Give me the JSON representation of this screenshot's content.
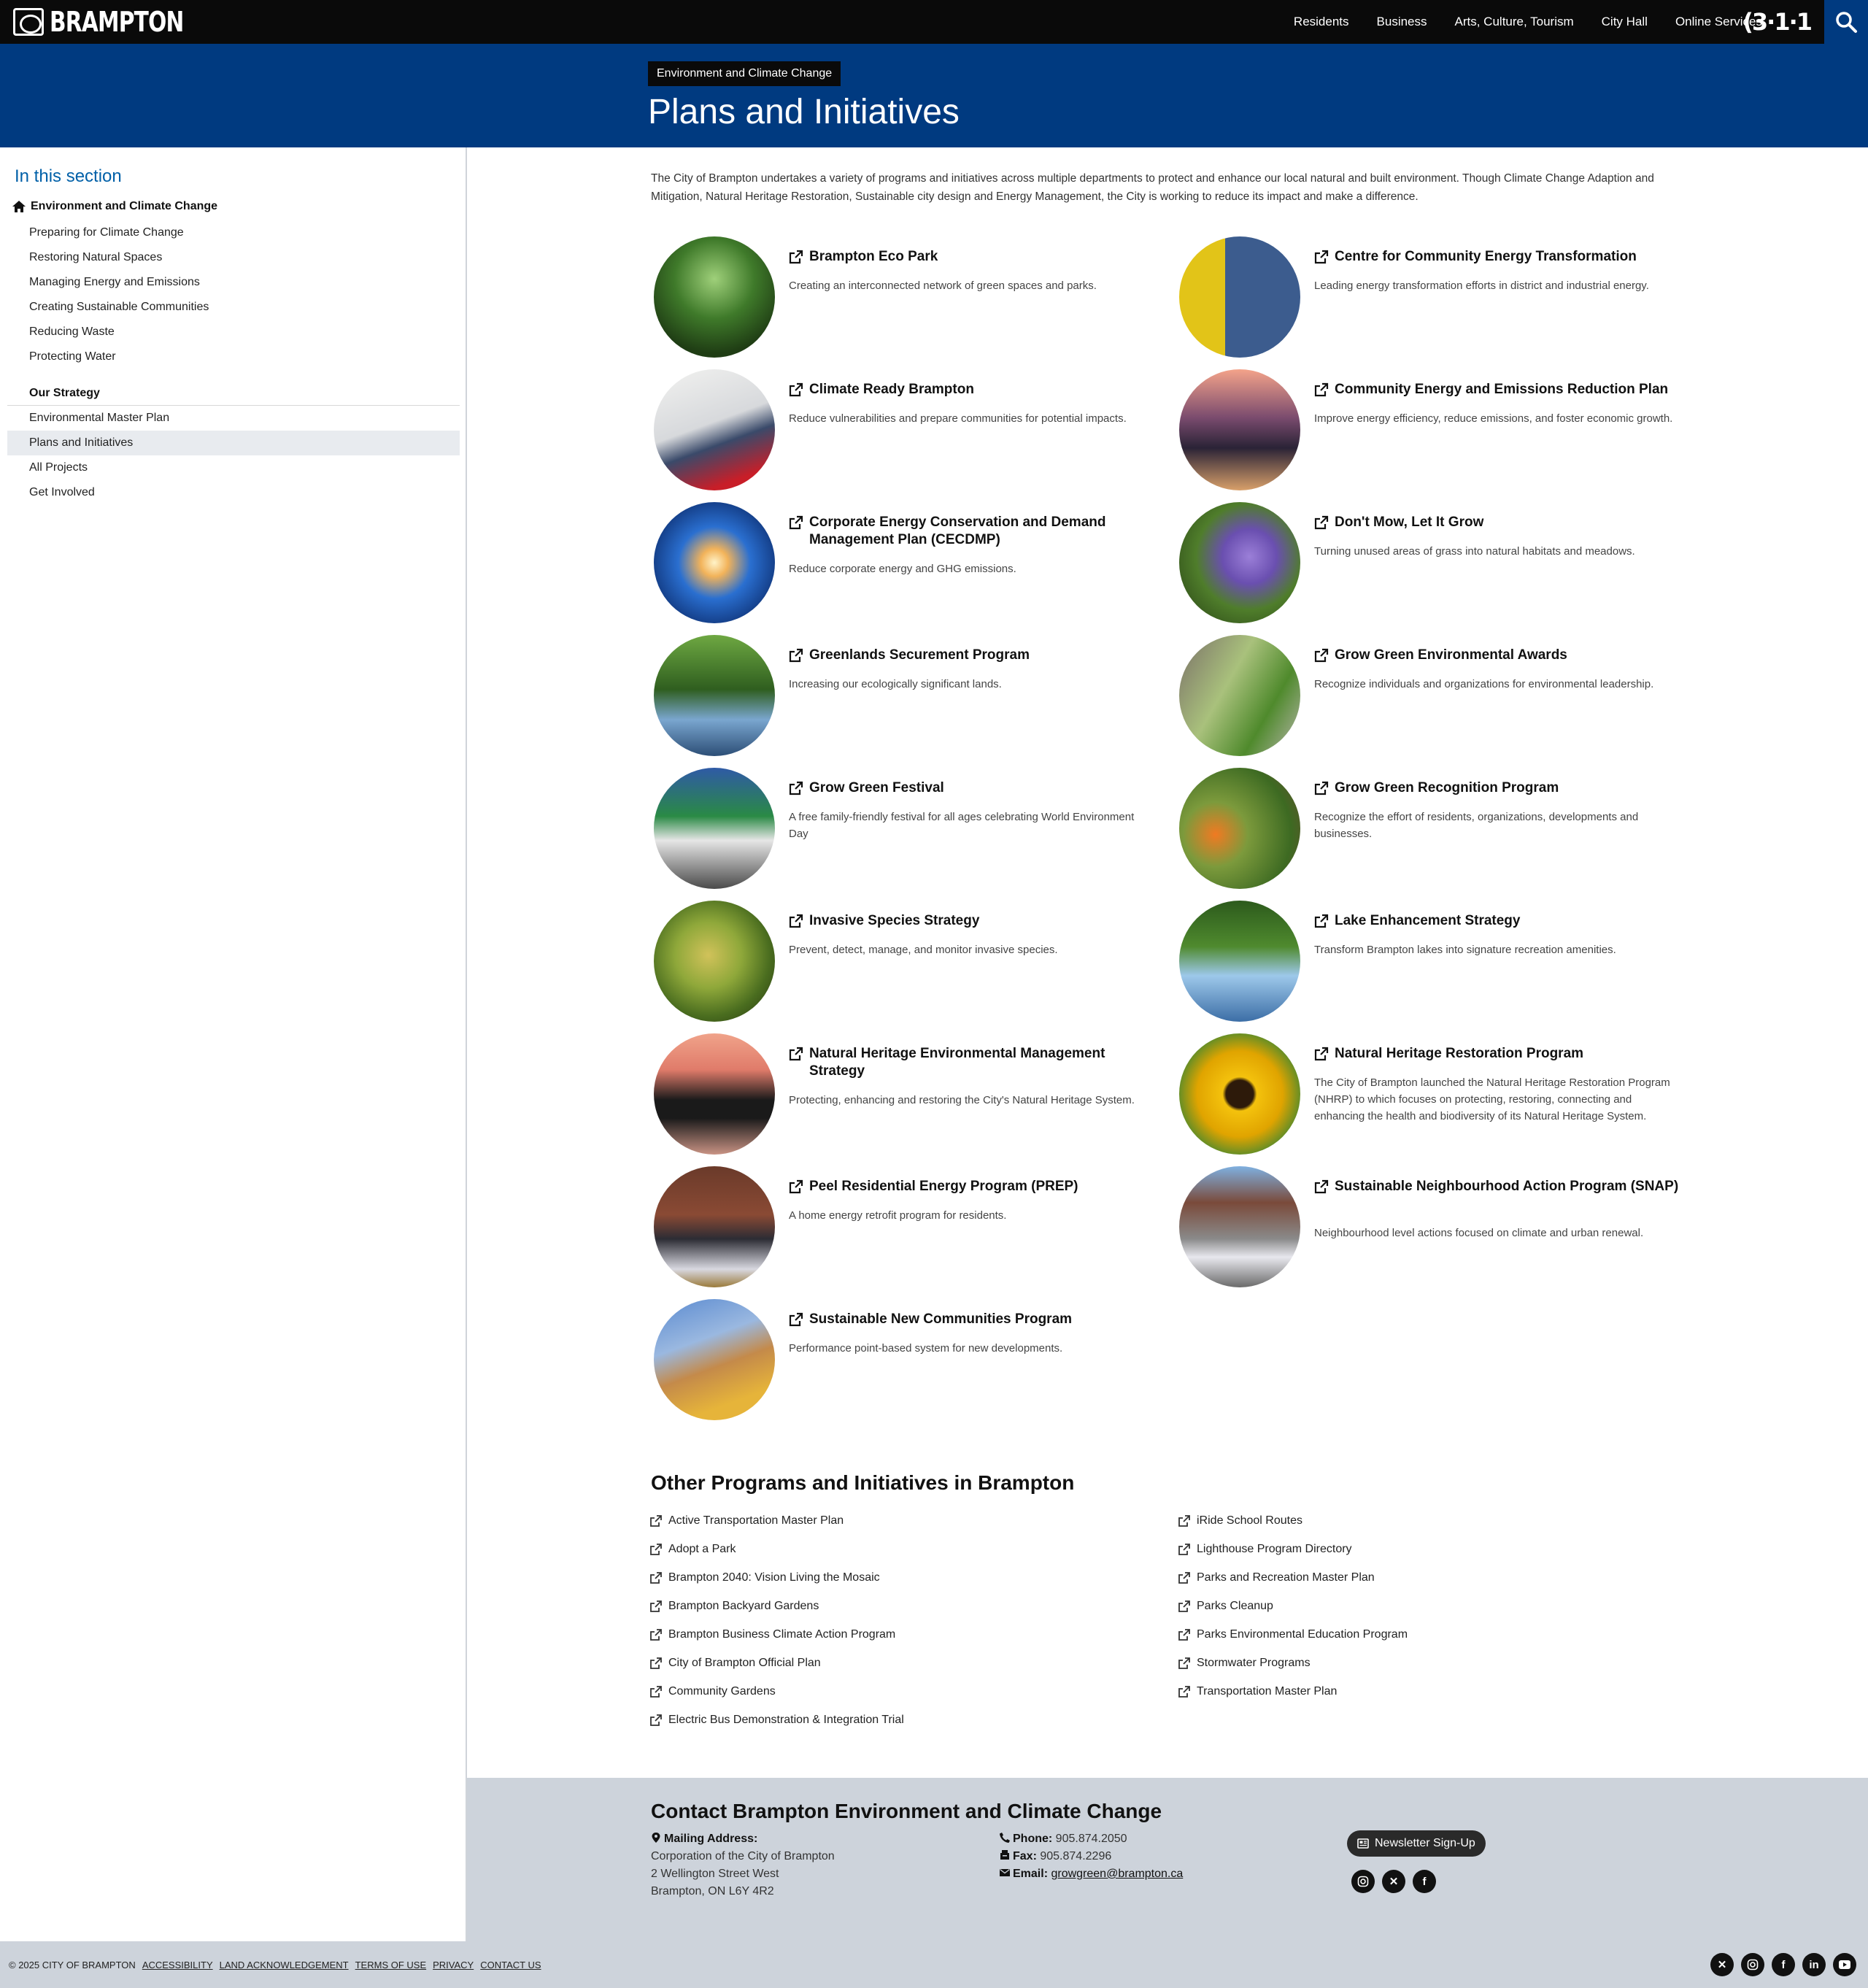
{
  "header": {
    "logo_text": "BRAMPTON",
    "nav": [
      "Residents",
      "Business",
      "Arts, Culture, Tourism",
      "City Hall",
      "Online Services"
    ],
    "n311": "(3·1·1",
    "accent": "#003a80"
  },
  "banner": {
    "crumb": "Environment and Climate Change",
    "title": "Plans and Initiatives"
  },
  "sidebar": {
    "heading": "In this section",
    "root": "Environment and Climate Change",
    "items": [
      "Preparing for Climate Change",
      "Restoring Natural Spaces",
      "Managing Energy and Emissions",
      "Creating Sustainable Communities",
      "Reducing Waste",
      "Protecting Water"
    ],
    "group": "Our Strategy",
    "strategy_items": [
      "Environmental Master Plan",
      "Plans and Initiatives",
      "All Projects",
      "Get Involved"
    ],
    "active": "Plans and Initiatives"
  },
  "intro": "The City of Brampton undertakes a variety of programs and initiatives across multiple departments to protect and enhance our local natural and built environment. Though Climate Change Adaption and Mitigation, Natural Heritage Restoration, Sustainable city design and Energy Management, the City is working to reduce its impact and make a difference.",
  "cards": [
    {
      "title": "Brampton Eco Park",
      "desc": "Creating an interconnected network of green spaces and parks.",
      "image": "park-path"
    },
    {
      "title": "Centre for Community Energy Transformation",
      "desc": "Leading energy transformation efforts in district and industrial energy.",
      "image": "hardhat-tower"
    },
    {
      "title": "Climate Ready Brampton",
      "desc": "Reduce vulnerabilities and prepare communities for potential impacts.",
      "image": "rain-boots"
    },
    {
      "title": "Community Energy and Emissions Reduction Plan",
      "desc": "Improve energy efficiency, reduce emissions, and foster economic growth.",
      "image": "city-skyline"
    },
    {
      "title": "Corporate Energy Conservation and Demand Management Plan (CECDMP)",
      "desc": "Reduce corporate energy and GHG emissions.",
      "image": "lightbulb"
    },
    {
      "title": "Don't Mow, Let It Grow",
      "desc": "Turning unused areas of grass into natural habitats and meadows.",
      "image": "bee-flower"
    },
    {
      "title": "Greenlands Securement Program",
      "desc": "Increasing our ecologically significant lands.",
      "image": "wetland"
    },
    {
      "title": "Grow Green Environmental Awards",
      "desc": "Recognize individuals and organizations for environmental leadership.",
      "image": "street-trees"
    },
    {
      "title": "Grow Green Festival",
      "desc": "A free family-friendly festival for all ages celebrating World Environment Day",
      "image": "festival-tents"
    },
    {
      "title": "Grow Green Recognition Program",
      "desc": "Recognize the effort of residents, organizations, developments and businesses.",
      "image": "tree-planting"
    },
    {
      "title": "Invasive Species Strategy",
      "desc": "Prevent, detect, manage, and monitor invasive species.",
      "image": "forest-stream"
    },
    {
      "title": "Lake Enhancement Strategy",
      "desc": "Transform Brampton lakes into signature recreation amenities.",
      "image": "river"
    },
    {
      "title": "Natural Heritage Environmental Management Strategy",
      "desc": "Protecting, enhancing and restoring the City's Natural Heritage System.",
      "image": "sunset-lake"
    },
    {
      "title": "Natural Heritage Restoration Program",
      "desc": "The City of Brampton launched the Natural Heritage Restoration Program (NHRP) to which focuses on protecting, restoring, connecting and enhancing the health and biodiversity of its Natural Heritage System.",
      "image": "sunflower"
    },
    {
      "title": "Peel Residential Energy Program (PREP)",
      "desc": "A home energy retrofit program for residents.",
      "image": "arena"
    },
    {
      "title": "Sustainable Neighbourhood Action Program (SNAP)",
      "desc": "Neighbourhood level actions focused on climate and urban renewal.",
      "image": "bus-street"
    },
    {
      "title": "Sustainable New Communities Program",
      "desc": "Performance point-based system for new developments.",
      "image": "construction"
    }
  ],
  "other": {
    "heading": "Other Programs and Initiatives in Brampton",
    "col1": [
      "Active Transportation Master Plan",
      "Adopt a Park",
      "Brampton 2040: Vision Living the Mosaic",
      "Brampton Backyard Gardens",
      "Brampton Business Climate Action Program",
      "City of Brampton Official Plan",
      "Community Gardens",
      "Electric Bus Demonstration & Integration Trial"
    ],
    "col2": [
      "iRide School Routes",
      "Lighthouse Program Directory",
      "Parks and Recreation Master Plan",
      "Parks Cleanup",
      "Parks Environmental Education Program",
      "Stormwater Programs",
      "Transportation Master Plan"
    ]
  },
  "contact": {
    "heading": "Contact Brampton Environment and Climate Change",
    "mail_label": "Mailing Address:",
    "mail_lines": [
      "Corporation of the City of Brampton",
      "2 Wellington Street West",
      "Brampton, ON L6Y 4R2"
    ],
    "phone_label": "Phone:",
    "phone": "905.874.2050",
    "fax_label": "Fax:",
    "fax": "905.874.2296",
    "email_label": "Email:",
    "email": "growgreen@brampton.ca",
    "newsletter": "Newsletter Sign-Up",
    "social": [
      "instagram-icon",
      "x-icon",
      "facebook-icon"
    ]
  },
  "footer": {
    "copyright": "© 2025 CITY OF BRAMPTON",
    "links": [
      "ACCESSIBILITY",
      "LAND ACKNOWLEDGEMENT",
      "TERMS OF USE",
      "PRIVACY",
      "CONTACT US"
    ],
    "social": [
      "x-icon",
      "instagram-icon",
      "facebook-icon",
      "linkedin-icon",
      "youtube-icon"
    ]
  }
}
